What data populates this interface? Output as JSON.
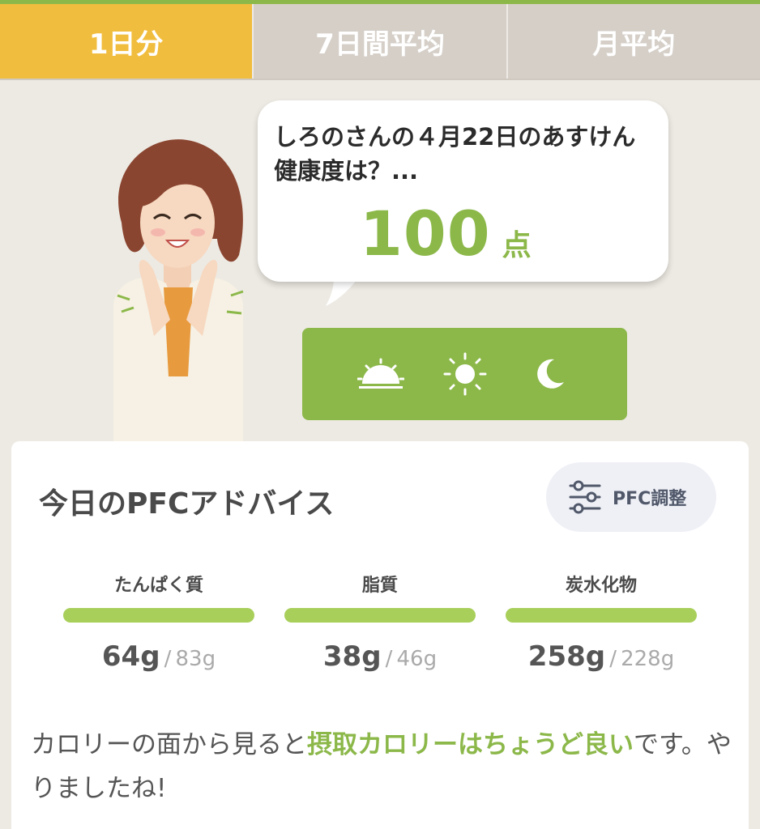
{
  "tabs": [
    {
      "label": "1日分",
      "active": true
    },
    {
      "label": "7日間平均",
      "active": false
    },
    {
      "label": "月平均",
      "active": false
    }
  ],
  "speech": {
    "question": "しろのさんの４月22日のあすけん健康度は？...",
    "score": "100",
    "score_unit": "点"
  },
  "meal_icons": [
    "sunrise-icon",
    "sun-icon",
    "moon-icon"
  ],
  "advice_card": {
    "title": "今日のPFCアドバイス",
    "adjust_button": "PFC調整",
    "macros": [
      {
        "name": "たんぱく質",
        "value": "64g",
        "separator": "/",
        "target": "83g"
      },
      {
        "name": "脂質",
        "value": "38g",
        "separator": "/",
        "target": "46g"
      },
      {
        "name": "炭水化物",
        "value": "258g",
        "separator": "/",
        "target": "228g"
      }
    ],
    "message_prefix": "カロリーの面から見ると",
    "message_highlight": "摂取カロリーはちょうど良い",
    "message_suffix": "です。やりましたね!"
  },
  "colors": {
    "accent_green": "#8cb84a",
    "tab_active": "#f1bd3e",
    "tab_inactive": "#d5cfc8",
    "background": "#edeae3"
  }
}
